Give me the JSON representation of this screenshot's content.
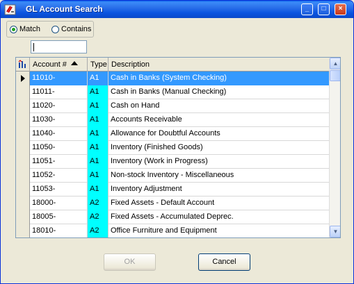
{
  "window": {
    "title": "GL Account Search",
    "controls": {
      "minimize": "_",
      "maximize": "□",
      "close": "×"
    }
  },
  "search_mode": {
    "match_label": "Match",
    "contains_label": "Contains",
    "selected": "Match"
  },
  "search": {
    "value": ""
  },
  "grid": {
    "columns": [
      "Account #",
      "Type",
      "Description"
    ],
    "sorted_by": "Account #",
    "rows": [
      {
        "account": "11010-",
        "type": "A1",
        "description": "Cash in Banks (System Checking)",
        "selected": true
      },
      {
        "account": "11011-",
        "type": "A1",
        "description": "Cash in Banks (Manual Checking)",
        "selected": false
      },
      {
        "account": "11020-",
        "type": "A1",
        "description": "Cash on Hand",
        "selected": false
      },
      {
        "account": "11030-",
        "type": "A1",
        "description": "Accounts Receivable",
        "selected": false
      },
      {
        "account": "11040-",
        "type": "A1",
        "description": "Allowance for Doubtful Accounts",
        "selected": false
      },
      {
        "account": "11050-",
        "type": "A1",
        "description": "Inventory (Finished Goods)",
        "selected": false
      },
      {
        "account": "11051-",
        "type": "A1",
        "description": "Inventory (Work in Progress)",
        "selected": false
      },
      {
        "account": "11052-",
        "type": "A1",
        "description": "Non-stock Inventory - Miscellaneous",
        "selected": false
      },
      {
        "account": "11053-",
        "type": "A1",
        "description": "Inventory Adjustment",
        "selected": false
      },
      {
        "account": "18000-",
        "type": "A2",
        "description": "Fixed Assets - Default Account",
        "selected": false
      },
      {
        "account": "18005-",
        "type": "A2",
        "description": "Fixed Assets - Accumulated Deprec.",
        "selected": false
      },
      {
        "account": "18010-",
        "type": "A2",
        "description": "Office Furniture and Equipment",
        "selected": false
      }
    ]
  },
  "buttons": {
    "ok": "OK",
    "cancel": "Cancel"
  },
  "colors": {
    "type_column": "#00ffff",
    "selection": "#3399ff",
    "titlebar": "#0a5fe6"
  }
}
